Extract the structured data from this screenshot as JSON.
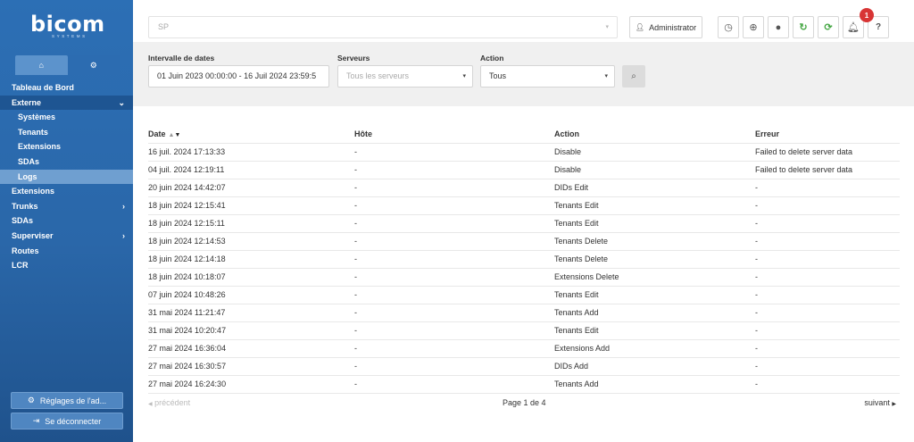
{
  "brand": {
    "logo": "bicom",
    "logo_sub": "SYSTEMS"
  },
  "sidebar": {
    "tabs": [
      {
        "icon": "home-icon",
        "glyph": "⌂"
      },
      {
        "icon": "gears-icon",
        "glyph": "⚙"
      }
    ],
    "items": [
      {
        "label": "Tableau de Bord"
      },
      {
        "label": "Externe",
        "chevron": "⌄"
      },
      {
        "label": "Systèmes"
      },
      {
        "label": "Tenants"
      },
      {
        "label": "Extensions"
      },
      {
        "label": "SDAs"
      },
      {
        "label": "Logs"
      },
      {
        "label": "Extensions"
      },
      {
        "label": "Trunks",
        "chevron": "›"
      },
      {
        "label": "SDAs"
      },
      {
        "label": "Superviser",
        "chevron": "›"
      },
      {
        "label": "Routes"
      },
      {
        "label": "LCR"
      }
    ],
    "settings_button": "Réglages de l'ad...",
    "logout_button": "Se déconnecter"
  },
  "topbar": {
    "tenant_value": "SP",
    "admin_label": "Administrator",
    "notification_count": "1",
    "help_label": "?"
  },
  "filters": {
    "date_label": "Intervalle de dates",
    "date_value": "01 Juin 2023 00:00:00 - 16 Juil 2024 23:59:5",
    "servers_label": "Serveurs",
    "servers_placeholder": "Tous les serveurs",
    "action_label": "Action",
    "action_value": "Tous"
  },
  "table": {
    "columns": [
      "Date",
      "Hôte",
      "Action",
      "Erreur"
    ],
    "rows": [
      {
        "date": "16 juil. 2024 17:13:33",
        "host": "-",
        "action": "Disable",
        "error": "Failed to delete server data"
      },
      {
        "date": "04 juil. 2024 12:19:11",
        "host": "-",
        "action": "Disable",
        "error": "Failed to delete server data"
      },
      {
        "date": "20 juin 2024 14:42:07",
        "host": "-",
        "action": "DIDs Edit",
        "error": "-"
      },
      {
        "date": "18 juin 2024 12:15:41",
        "host": "-",
        "action": "Tenants Edit",
        "error": "-"
      },
      {
        "date": "18 juin 2024 12:15:11",
        "host": "-",
        "action": "Tenants Edit",
        "error": "-"
      },
      {
        "date": "18 juin 2024 12:14:53",
        "host": "-",
        "action": "Tenants Delete",
        "error": "-"
      },
      {
        "date": "18 juin 2024 12:14:18",
        "host": "-",
        "action": "Tenants Delete",
        "error": "-"
      },
      {
        "date": "18 juin 2024 10:18:07",
        "host": "-",
        "action": "Extensions Delete",
        "error": "-"
      },
      {
        "date": "07 juin 2024 10:48:26",
        "host": "-",
        "action": "Tenants Edit",
        "error": "-"
      },
      {
        "date": "31 mai 2024 11:21:47",
        "host": "-",
        "action": "Tenants Add",
        "error": "-"
      },
      {
        "date": "31 mai 2024 10:20:47",
        "host": "-",
        "action": "Tenants Edit",
        "error": "-"
      },
      {
        "date": "27 mai 2024 16:36:04",
        "host": "-",
        "action": "Extensions Add",
        "error": "-"
      },
      {
        "date": "27 mai 2024 16:30:57",
        "host": "-",
        "action": "DIDs Add",
        "error": "-"
      },
      {
        "date": "27 mai 2024 16:24:30",
        "host": "-",
        "action": "Tenants Add",
        "error": "-"
      }
    ]
  },
  "pager": {
    "prev": "précédent",
    "page": "Page 1 de 4",
    "next": "suivant"
  },
  "colors": {
    "sidebar": "#2c6fb5",
    "active_item": "#6f9fd0",
    "badge": "#d83535",
    "green_icon": "#48a847"
  }
}
